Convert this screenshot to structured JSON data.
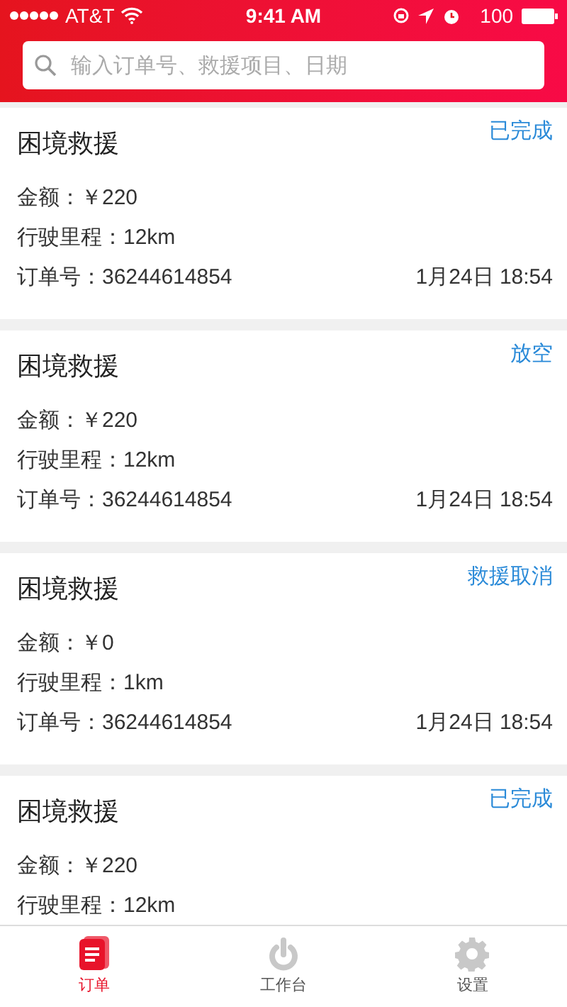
{
  "status_bar": {
    "carrier": "AT&T",
    "time": "9:41 AM",
    "battery": "100"
  },
  "search": {
    "placeholder": "输入订单号、救援项目、日期"
  },
  "orders": [
    {
      "title": "困境救援",
      "status": "已完成",
      "amount": "金额：￥220",
      "distance": "行驶里程：12km",
      "order_no": "订单号：36244614854",
      "date": "1月24日 18:54"
    },
    {
      "title": "困境救援",
      "status": "放空",
      "amount": "金额：￥220",
      "distance": "行驶里程：12km",
      "order_no": "订单号：36244614854",
      "date": "1月24日 18:54"
    },
    {
      "title": "困境救援",
      "status": "救援取消",
      "amount": "金额：￥0",
      "distance": "行驶里程：1km",
      "order_no": "订单号：36244614854",
      "date": "1月24日 18:54"
    },
    {
      "title": "困境救援",
      "status": "已完成",
      "amount": "金额：￥220",
      "distance": "行驶里程：12km"
    }
  ],
  "tab_bar": [
    {
      "kind": "orders",
      "label": "订单",
      "selected": true
    },
    {
      "kind": "workbench",
      "label": "工作台",
      "selected": false
    },
    {
      "kind": "settings",
      "label": "设置",
      "selected": false
    }
  ]
}
